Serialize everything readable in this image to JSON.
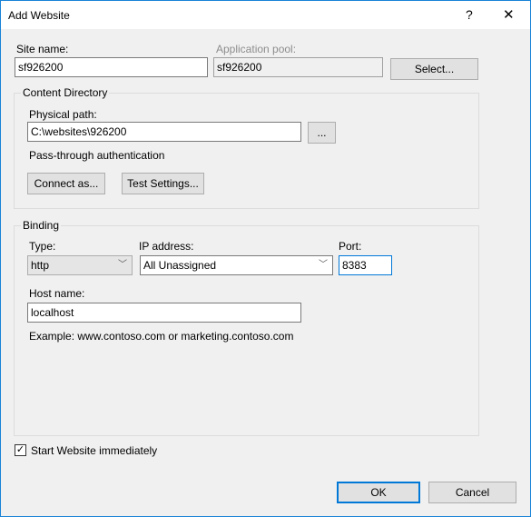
{
  "window": {
    "title": "Add Website",
    "help_label": "?",
    "close_label": "✕"
  },
  "site": {
    "name_label": "Site name:",
    "name_value": "sf926200",
    "pool_label": "Application pool:",
    "pool_value": "sf926200",
    "select_label": "Select..."
  },
  "content": {
    "group_label": "Content Directory",
    "path_label": "Physical path:",
    "path_value": "C:\\websites\\926200",
    "browse_label": "...",
    "auth_text": "Pass-through authentication",
    "connect_label": "Connect as...",
    "test_label": "Test Settings..."
  },
  "binding": {
    "group_label": "Binding",
    "type_label": "Type:",
    "type_value": "http",
    "ip_label": "IP address:",
    "ip_value": "All Unassigned",
    "port_label": "Port:",
    "port_value": "8383",
    "host_label": "Host name:",
    "host_value": "localhost",
    "example_text": "Example: www.contoso.com or marketing.contoso.com"
  },
  "start": {
    "label": "Start Website immediately",
    "checked": true
  },
  "footer": {
    "ok_label": "OK",
    "cancel_label": "Cancel"
  },
  "colors": {
    "accent": "#0078d7"
  }
}
